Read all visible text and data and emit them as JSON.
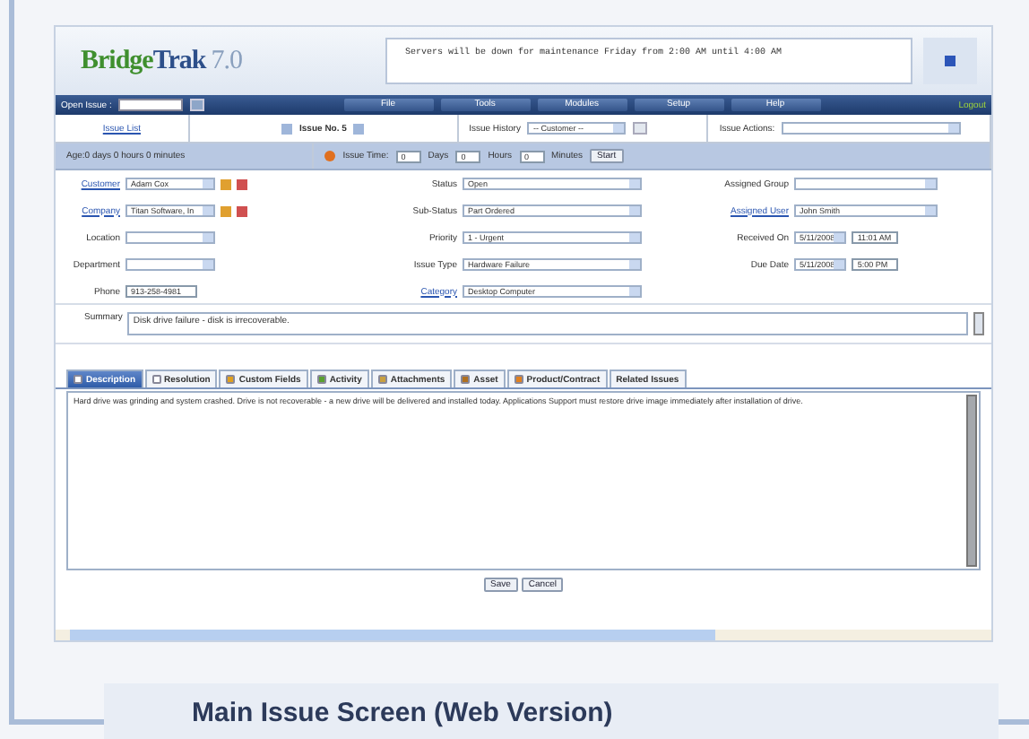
{
  "app": {
    "logo_main": "Bridge",
    "logo_accent": "Trak",
    "version": "7.0",
    "announcement": "Servers will be down for maintenance Friday from 2:00 AM until 4:00 AM"
  },
  "navbar": {
    "open_issue_label": "Open Issue :",
    "menu": [
      "File",
      "Tools",
      "Modules",
      "Setup",
      "Help"
    ],
    "logout": "Logout"
  },
  "issue_bar": {
    "issue_list": "Issue List",
    "issue_no": "Issue No. 5",
    "history_label": "Issue History",
    "history_value": "-- Customer --",
    "actions_label": "Issue Actions:"
  },
  "timer": {
    "age": "Age:0 days 0 hours 0 minutes",
    "label": "Issue Time:",
    "days": "0",
    "days_label": "Days",
    "hours": "0",
    "hours_label": "Hours",
    "minutes": "0",
    "minutes_label": "Minutes",
    "start": "Start"
  },
  "columns": [
    [
      {
        "label": "Customer",
        "link": true,
        "kind": "select",
        "value": "Adam Cox",
        "tools": true
      },
      {
        "label": "Company",
        "link": true,
        "kind": "select",
        "value": "Titan Software, In",
        "tools": true
      },
      {
        "label": "Location",
        "link": false,
        "kind": "select"
      },
      {
        "label": "Department",
        "link": false,
        "kind": "select"
      },
      {
        "label": "Phone",
        "link": false,
        "kind": "input",
        "value": "913-258-4981"
      }
    ],
    [
      {
        "label": "Status",
        "link": false,
        "kind": "select",
        "value": "Open"
      },
      {
        "label": "Sub-Status",
        "link": false,
        "kind": "select",
        "value": "Part Ordered"
      },
      {
        "label": "Priority",
        "link": false,
        "kind": "select",
        "value": "1 - Urgent"
      },
      {
        "label": "Issue Type",
        "link": false,
        "kind": "select",
        "value": "Hardware Failure"
      },
      {
        "label": "Category",
        "link": true,
        "kind": "select",
        "value": "Desktop Computer"
      }
    ],
    [
      {
        "label": "Assigned Group",
        "link": false,
        "kind": "select"
      },
      {
        "label": "Assigned User",
        "link": true,
        "kind": "select",
        "value": "John Smith"
      },
      {
        "label": "Received On",
        "link": false,
        "kind": "date",
        "value": "5/11/2008",
        "time": "11:01 AM"
      },
      {
        "label": "Due Date",
        "link": false,
        "kind": "date",
        "value": "5/11/2008",
        "time": "5:00 PM"
      }
    ]
  ],
  "summary": {
    "label": "Summary",
    "value": "Disk drive failure - disk is irrecoverable."
  },
  "tabs": [
    {
      "label": "Description",
      "selected": true
    },
    {
      "label": "Resolution",
      "selected": false
    },
    {
      "label": "Custom Fields",
      "selected": false
    },
    {
      "label": "Activity",
      "selected": false
    },
    {
      "label": "Attachments",
      "selected": false
    },
    {
      "label": "Asset",
      "selected": false
    },
    {
      "label": "Product/Contract",
      "selected": false
    },
    {
      "label": "Related Issues",
      "selected": false
    }
  ],
  "description": "Hard drive was grinding and system crashed.  Drive is not recoverable - a new drive will be delivered and installed today.  Applications Support must restore drive image immediately after installation of drive.",
  "buttons": [
    "Save",
    "Cancel"
  ],
  "caption": "Main Issue Screen (Web Version)"
}
